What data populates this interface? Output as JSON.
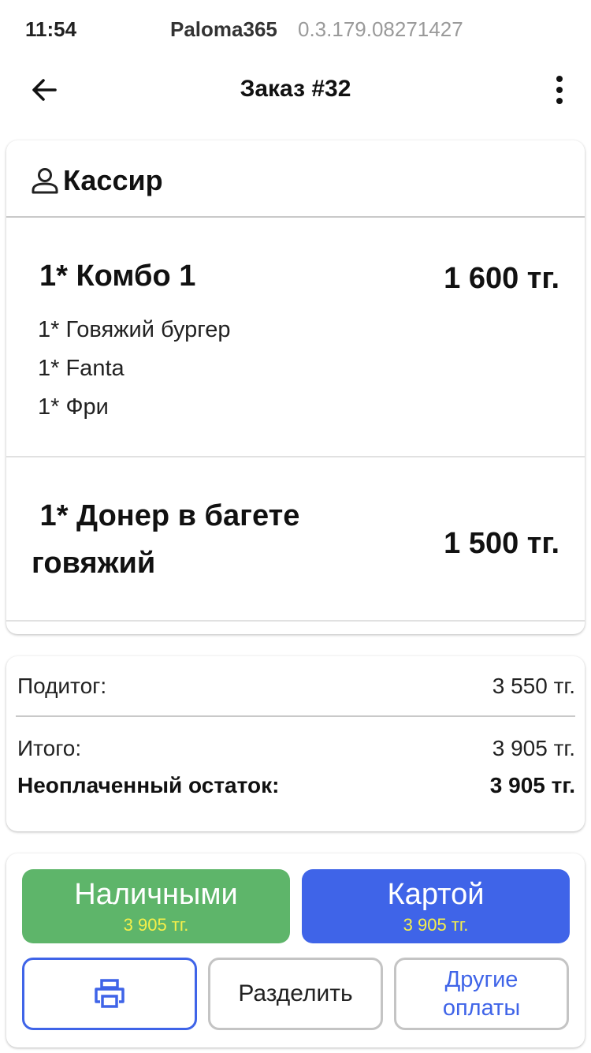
{
  "status_bar": {
    "time": "11:54",
    "app_name": "Paloma365",
    "version": "0.3.179.08271427"
  },
  "app_bar": {
    "title": "Заказ #32",
    "back_icon": "arrow-left-icon",
    "menu_icon": "more-vertical-icon"
  },
  "order": {
    "cashier_label": "Кассир",
    "cashier_icon": "user-icon",
    "items": [
      {
        "name": "1* Комбо 1",
        "price": "1 600  тг.",
        "sub_items": [
          "1* Говяжий бургер",
          "1* Fanta",
          "1* Фри"
        ]
      },
      {
        "name_line_1": " 1* Донер в багете",
        "name_line_2": "говяжий",
        "price": "1 500  тг."
      }
    ]
  },
  "totals": {
    "subtotal_label": "Подитог:",
    "subtotal_value": "3 550  тг.",
    "total_label": "Итого:",
    "total_value": "3 905  тг.",
    "unpaid_label": "Неоплаченный остаток:",
    "unpaid_value": "3 905  тг."
  },
  "actions": {
    "cash_label": "Наличными",
    "cash_amount": "3 905  тг.",
    "card_label": "Картой",
    "card_amount": "3 905  тг.",
    "print_icon": "printer-icon",
    "split_label": "Разделить",
    "other_line_1": "Другие",
    "other_line_2": "оплаты"
  },
  "colors": {
    "cash_button": "#5eb56a",
    "card_button": "#3f64e8",
    "amount_text": "#f6f04a",
    "accent": "#3f64e8"
  }
}
